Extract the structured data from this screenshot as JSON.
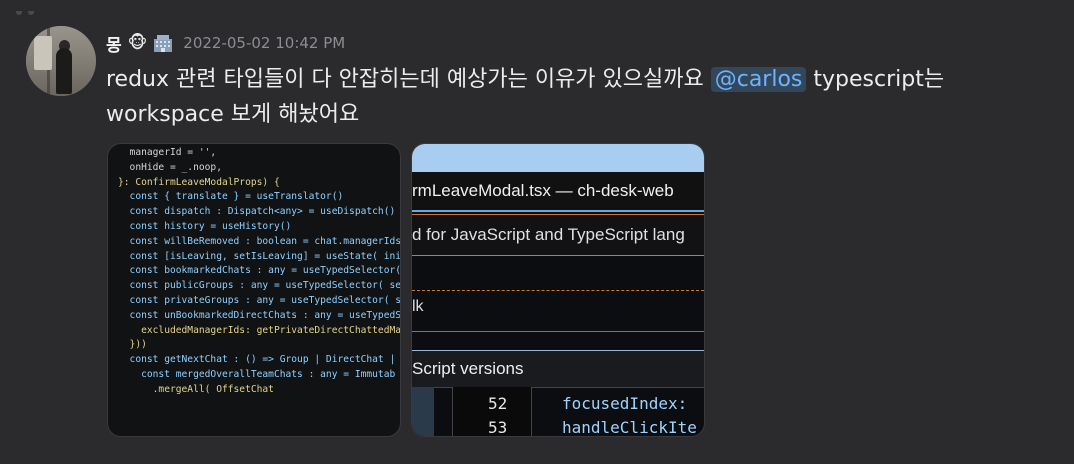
{
  "message": {
    "username": "몽",
    "emoji": "🐵",
    "timestamp": "2022-05-02 10:42 PM",
    "text_before": "redux 관련 타입들이 다 안잡히는데 예상가는 이유가 있으실까요 ",
    "mention": "@carlos",
    "text_after": " typescript는 workspace 보게 해놨어요"
  },
  "attachment1": {
    "code_lines": [
      "  managerId = '',",
      "  onHide = _.noop,",
      "}: ConfirmLeaveModalProps) {",
      "  const { translate } = useTranslator()",
      "  const dispatch : Dispatch<any> = useDispatch()",
      "  const history = useHistory()",
      "",
      "  const willBeRemoved : boolean = chat.managerIds.",
      "",
      "  const [isLeaving, setIsLeaving] = useState( init",
      "",
      "  const bookmarkedChats : any = useTypedSelector(",
      "  const publicGroups : any = useTypedSelector( sele",
      "  const privateGroups : any = useTypedSelector( se",
      "  const unBookmarkedDirectChats : any = useTypedSe",
      "    excludedManagerIds: getPrivateDirectChattedMa",
      "  }))",
      "",
      "  const getNextChat : () => Group | DirectChat | ... =",
      "    const mergedOverallTeamChats : any = Immutab",
      "      .mergeAll( OffsetChat"
    ]
  },
  "attachment2": {
    "title": "rmLeaveModal.tsx — ch-desk-web",
    "row1": "d for JavaScript and TypeScript lang",
    "row2": "lk",
    "row3": "Script versions",
    "lines": [
      {
        "num": "52",
        "code": "focusedIndex:"
      },
      {
        "num": "53",
        "code": "handleClickIte"
      }
    ]
  }
}
